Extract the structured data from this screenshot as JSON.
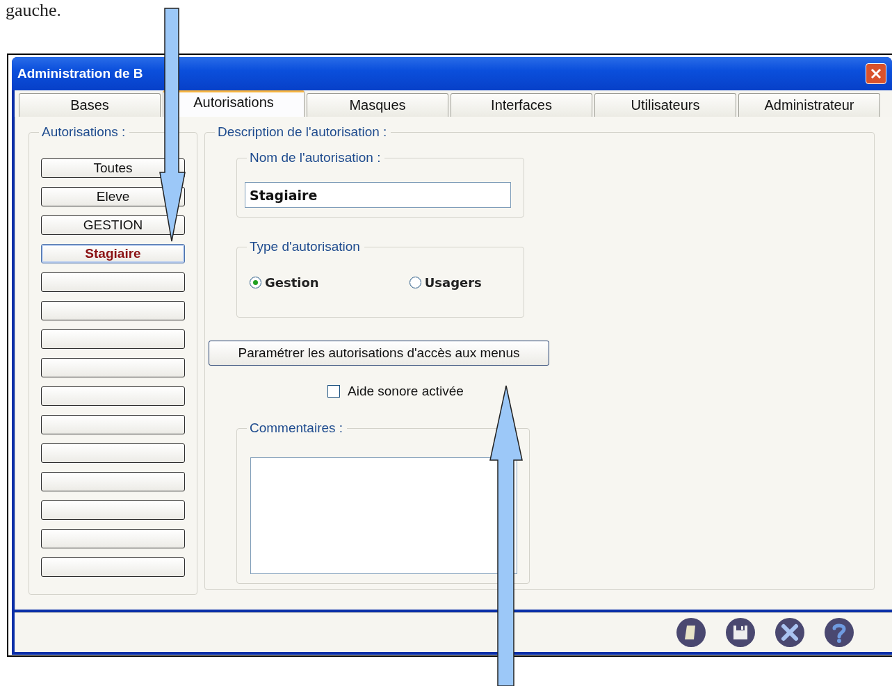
{
  "document_text": "gauche.",
  "window": {
    "title": "Administration de B"
  },
  "tabs": [
    {
      "label": "Bases",
      "selected": false
    },
    {
      "label": "Autorisations",
      "selected": true
    },
    {
      "label": "Masques",
      "selected": false
    },
    {
      "label": "Interfaces",
      "selected": false
    },
    {
      "label": "Utilisateurs",
      "selected": false
    },
    {
      "label": "Administrateur",
      "selected": false
    }
  ],
  "authorisations": {
    "title": "Autorisations :",
    "items": [
      {
        "label": "Toutes",
        "selected": false
      },
      {
        "label": "Eleve",
        "selected": false
      },
      {
        "label": "GESTION",
        "selected": false
      },
      {
        "label": "Stagiaire",
        "selected": true
      },
      {
        "selected": false
      },
      {
        "selected": false
      },
      {
        "selected": false
      },
      {
        "selected": false
      },
      {
        "selected": false
      },
      {
        "selected": false
      },
      {
        "selected": false
      },
      {
        "selected": false
      },
      {
        "selected": false
      },
      {
        "selected": false
      },
      {
        "selected": false
      }
    ]
  },
  "description": {
    "title": "Description de l'autorisation :",
    "name_group": {
      "title": "Nom de l'autorisation :",
      "value": "Stagiaire"
    },
    "type_group": {
      "title": "Type d'autorisation",
      "options": [
        {
          "label": "Gestion",
          "selected": true
        },
        {
          "label": "Usagers",
          "selected": false
        }
      ]
    },
    "menu_button": "Paramétrer les autorisations d'accès aux menus",
    "sound_checkbox": {
      "label": "Aide sonore activée",
      "checked": false
    },
    "comments": {
      "title": "Commentaires :"
    }
  }
}
